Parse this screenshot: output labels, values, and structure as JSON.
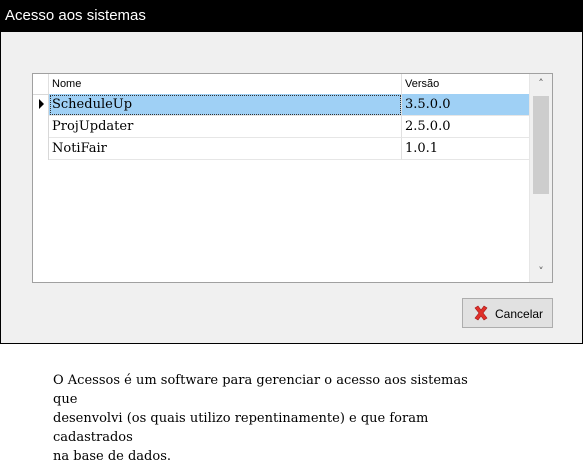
{
  "window": {
    "title": "Acesso aos sistemas"
  },
  "grid": {
    "columns": [
      "Nome",
      "Versão"
    ],
    "rows": [
      {
        "nome": "ScheduleUp",
        "versao": "3.5.0.0",
        "selected": true
      },
      {
        "nome": "ProjUpdater",
        "versao": "2.5.0.0",
        "selected": false
      },
      {
        "nome": "NotiFair",
        "versao": "1.0.1",
        "selected": false
      }
    ]
  },
  "buttons": {
    "cancel_label": "Cancelar",
    "cancel_icon": "red-x-icon"
  },
  "colors": {
    "title_bg": "#000000",
    "selection": "#9fd0f5",
    "cancel_icon": "#e0302a"
  },
  "description": {
    "line1": "O Acessos é um software para gerenciar o acesso aos sistemas que",
    "line2": "desenvolvi (os quais utilizo repentinamente) e que foram cadastrados",
    "line3": "na base de dados."
  }
}
